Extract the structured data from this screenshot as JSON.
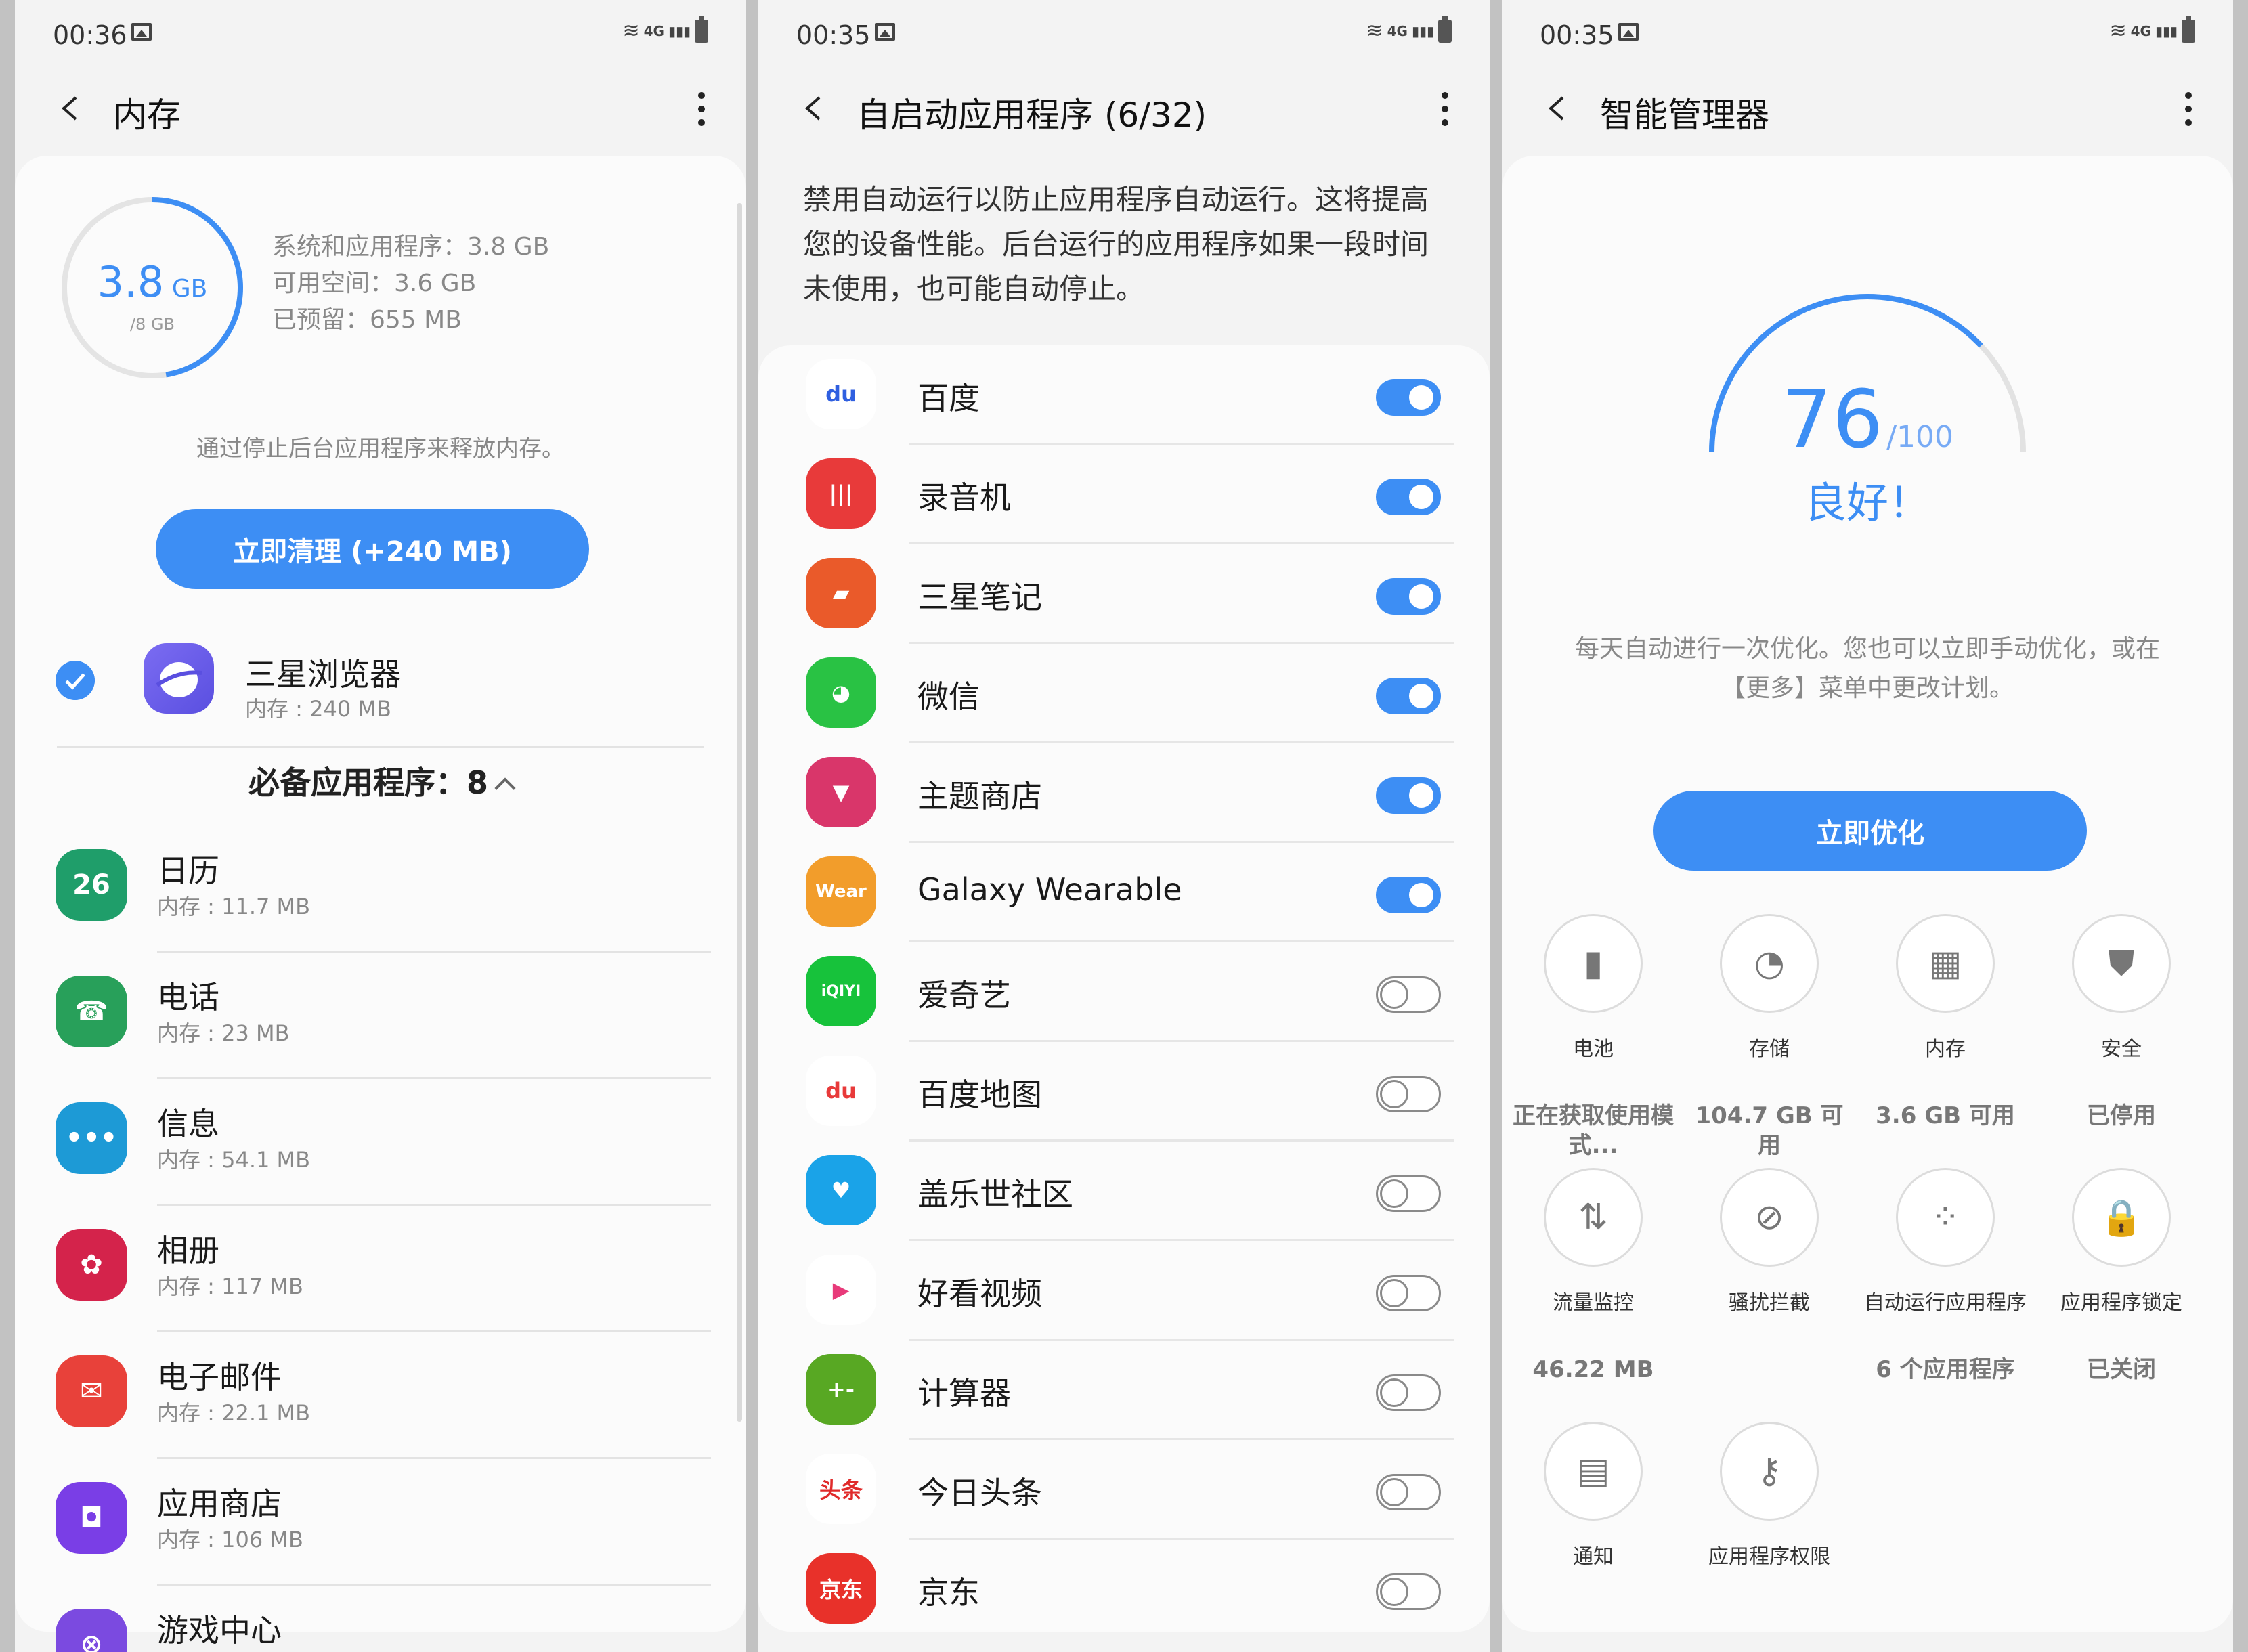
{
  "screens": [
    {
      "status": {
        "time": "00:36",
        "network": "4G"
      },
      "title": "内存",
      "memory": {
        "used_value": "3.8",
        "used_unit": "GB",
        "total": "/8 GB",
        "used_fraction": 0.475,
        "stats": [
          "系统和应用程序：3.8 GB",
          "可用空间：3.6 GB",
          "已预留：655 MB"
        ]
      },
      "hint": "通过停止后台应用程序来释放内存。",
      "clean_button": "立即清理 (+240 MB)",
      "selected_app": {
        "name": "三星浏览器",
        "mem": "内存 : 240 MB",
        "icon": "internet-icon"
      },
      "section_header": "必备应用程序：8",
      "apps": [
        {
          "name": "日历",
          "mem": "内存 : 11.7 MB",
          "icon": "calendar-icon",
          "badge": "26",
          "color": "#1f9e6a"
        },
        {
          "name": "电话",
          "mem": "内存 : 23 MB",
          "icon": "phone-icon",
          "badge": "",
          "color": "#28a05a"
        },
        {
          "name": "信息",
          "mem": "内存 : 54.1 MB",
          "icon": "messages-icon",
          "badge": "",
          "color": "#1d9ad6"
        },
        {
          "name": "相册",
          "mem": "内存 : 117 MB",
          "icon": "gallery-icon",
          "badge": "",
          "color": "#d4234b"
        },
        {
          "name": "电子邮件",
          "mem": "内存 : 22.1 MB",
          "icon": "email-icon",
          "badge": "",
          "color": "#e8413a"
        },
        {
          "name": "应用商店",
          "mem": "内存 : 106 MB",
          "icon": "store-icon",
          "badge": "",
          "color": "#7a3ee6"
        },
        {
          "name": "游戏中心",
          "mem": "",
          "icon": "game-icon",
          "badge": "",
          "color": "#7b4ae0"
        }
      ]
    },
    {
      "status": {
        "time": "00:35",
        "network": "4G"
      },
      "title": "自启动应用程序 (6/32)",
      "description": "禁用自动运行以防止应用程序自动运行。这将提高您的设备性能。后台运行的应用程序如果一段时间未使用，也可能自动停止。",
      "apps": [
        {
          "name": "百度",
          "on": true,
          "icon": "baidu-icon",
          "badge": "du",
          "color": "#ffffff",
          "fg": "#2f5fe0"
        },
        {
          "name": "录音机",
          "on": true,
          "icon": "voice-recorder-icon",
          "badge": "|||",
          "color": "#e83a3a",
          "fg": "#ffffff"
        },
        {
          "name": "三星笔记",
          "on": true,
          "icon": "notes-icon",
          "badge": "",
          "color": "#ea5a2a",
          "fg": "#ffffff"
        },
        {
          "name": "微信",
          "on": true,
          "icon": "wechat-icon",
          "badge": "",
          "color": "#29c244",
          "fg": "#ffffff"
        },
        {
          "name": "主题商店",
          "on": true,
          "icon": "themes-icon",
          "badge": "",
          "color": "#d9366a",
          "fg": "#ffffff"
        },
        {
          "name": "Galaxy Wearable",
          "on": true,
          "icon": "wearable-icon",
          "badge": "Wear",
          "color": "#f29d2b",
          "fg": "#ffffff"
        },
        {
          "name": "爱奇艺",
          "on": false,
          "icon": "iqiyi-icon",
          "badge": "iQIYI",
          "color": "#17c23b",
          "fg": "#ffffff"
        },
        {
          "name": "百度地图",
          "on": false,
          "icon": "baidu-map-icon",
          "badge": "du",
          "color": "#ffffff",
          "fg": "#e83a3a"
        },
        {
          "name": "盖乐世社区",
          "on": false,
          "icon": "community-icon",
          "badge": "",
          "color": "#1aa3e8",
          "fg": "#ffffff"
        },
        {
          "name": "好看视频",
          "on": false,
          "icon": "haokan-icon",
          "badge": "",
          "color": "#ffffff",
          "fg": "#e83a7a"
        },
        {
          "name": "计算器",
          "on": false,
          "icon": "calculator-icon",
          "badge": "+-",
          "color": "#58a823",
          "fg": "#ffffff"
        },
        {
          "name": "今日头条",
          "on": false,
          "icon": "toutiao-icon",
          "badge": "头条",
          "color": "#ffffff",
          "fg": "#e02a2a"
        },
        {
          "name": "京东",
          "on": false,
          "icon": "jd-icon",
          "badge": "京东",
          "color": "#e8312a",
          "fg": "#ffffff"
        }
      ]
    },
    {
      "status": {
        "time": "00:35",
        "network": "4G"
      },
      "title": "智能管理器",
      "score": {
        "value": "76",
        "max": "/100",
        "fraction": 0.76
      },
      "status_text": "良好！",
      "hint": "每天自动进行一次优化。您也可以立即手动优化，或在【更多】菜单中更改计划。",
      "optimize_button": "立即优化",
      "tiles": [
        {
          "label": "电池",
          "value": "正在获取使用模式...",
          "icon": "battery-icon"
        },
        {
          "label": "存储",
          "value": "104.7 GB 可用",
          "icon": "storage-icon"
        },
        {
          "label": "内存",
          "value": "3.6 GB 可用",
          "icon": "memory-icon"
        },
        {
          "label": "安全",
          "value": "已停用",
          "icon": "security-icon"
        },
        {
          "label": "流量监控",
          "value": "46.22 MB",
          "icon": "data-usage-icon"
        },
        {
          "label": "骚扰拦截",
          "value": "",
          "icon": "block-icon"
        },
        {
          "label": "自动运行应用程序",
          "value": "6 个应用程序",
          "icon": "auto-run-icon"
        },
        {
          "label": "应用程序锁定",
          "value": "已关闭",
          "icon": "lock-icon"
        },
        {
          "label": "通知",
          "value": "",
          "icon": "notification-icon"
        },
        {
          "label": "应用程序权限",
          "value": "",
          "icon": "key-icon"
        }
      ]
    }
  ]
}
